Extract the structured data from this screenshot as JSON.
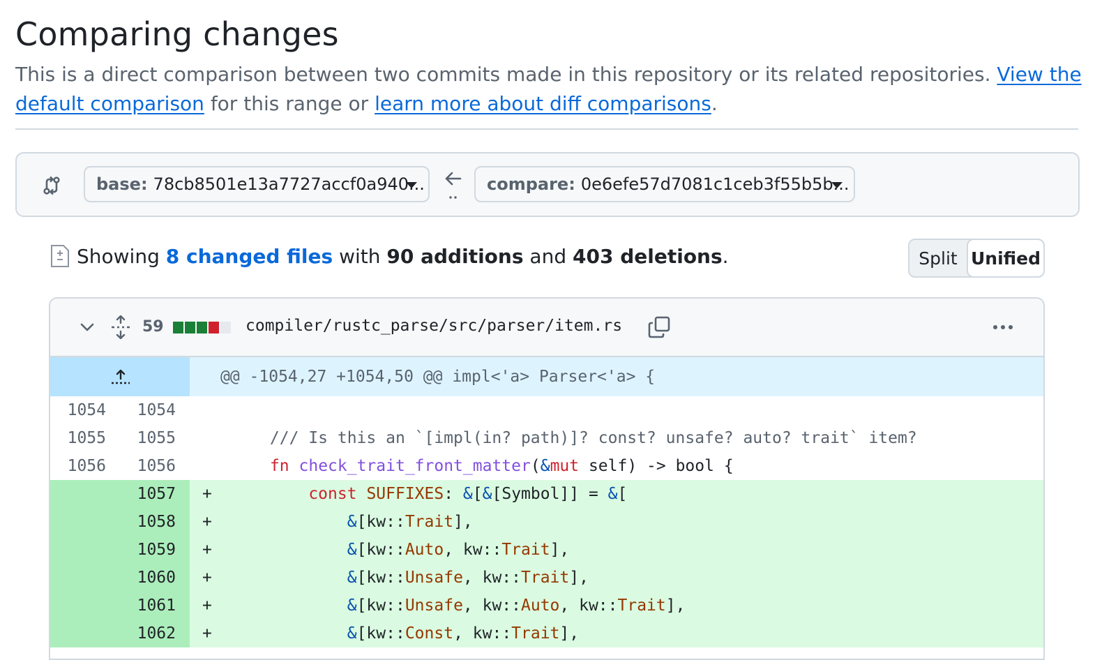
{
  "page": {
    "title": "Comparing changes",
    "desc_text1": "This is a direct comparison between two commits made in this repository or its related repositories. ",
    "desc_link1": "View the default comparison",
    "desc_text2": " for this range or ",
    "desc_link2": "learn more about diff comparisons",
    "desc_text3": "."
  },
  "range": {
    "base_label": "base:",
    "base_value": "78cb8501e13a7727accf0a940...",
    "compare_label": "compare:",
    "compare_value": "0e6efe57d7081c1ceb3f55b5b..."
  },
  "summary": {
    "showing": "Showing",
    "changed_files": "8 changed files",
    "with": "with",
    "additions": "90 additions",
    "and": "and",
    "deletions": "403 deletions",
    "end": "."
  },
  "view_toggle": {
    "split": "Split",
    "unified": "Unified",
    "selected": "Unified"
  },
  "file": {
    "changes_count": "59",
    "diffstat_colors": [
      "#1a7f37",
      "#1a7f37",
      "#1a7f37",
      "#cf222e",
      "#e6eaef"
    ],
    "path": "compiler/rustc_parse/src/parser/item.rs",
    "hunk_header": "@@ -1054,27 +1054,50 @@ impl<'a> Parser<'a> {"
  },
  "colors": {
    "link": "#0969da",
    "addition_bg": "#dafbe1",
    "addition_gutter": "#aceebb",
    "hunk_bg": "#ddf4ff",
    "hunk_gutter": "#b6e3ff"
  },
  "lines": [
    {
      "old": "1054",
      "new": "1054",
      "type": "ctx",
      "marker": "",
      "code": ""
    },
    {
      "old": "1055",
      "new": "1055",
      "type": "ctx",
      "marker": "",
      "code": "    /// Is this an `[impl(in? path)]? const? unsafe? auto? trait` item?"
    },
    {
      "old": "1056",
      "new": "1056",
      "type": "ctx",
      "marker": "",
      "code": "    fn check_trait_front_matter(&mut self) -> bool {"
    },
    {
      "old": "",
      "new": "1057",
      "type": "add",
      "marker": "+",
      "code": "        const SUFFIXES: &[&[Symbol]] = &["
    },
    {
      "old": "",
      "new": "1058",
      "type": "add",
      "marker": "+",
      "code": "            &[kw::Trait],"
    },
    {
      "old": "",
      "new": "1059",
      "type": "add",
      "marker": "+",
      "code": "            &[kw::Auto, kw::Trait],"
    },
    {
      "old": "",
      "new": "1060",
      "type": "add",
      "marker": "+",
      "code": "            &[kw::Unsafe, kw::Trait],"
    },
    {
      "old": "",
      "new": "1061",
      "type": "add",
      "marker": "+",
      "code": "            &[kw::Unsafe, kw::Auto, kw::Trait],"
    },
    {
      "old": "",
      "new": "1062",
      "type": "add",
      "marker": "+",
      "code": "            &[kw::Const, kw::Trait],"
    }
  ]
}
